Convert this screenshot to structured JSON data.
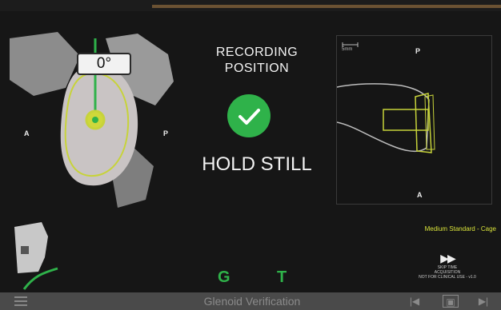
{
  "left_view": {
    "angle": "0°",
    "label_anterior": "A",
    "label_posterior": "P"
  },
  "status": {
    "line1": "RECORDING",
    "line2": "POSITION",
    "hold": "HOLD STILL"
  },
  "right_view": {
    "scale": "5mm",
    "label_top": "P",
    "label_bottom": "A"
  },
  "implant": "Medium Standard - Cage",
  "skip": {
    "line1": "SKIP TIME",
    "line2": "ACQUISITION",
    "line3": "NOT FOR CLINICAL USE - v1.0"
  },
  "mode_labels": {
    "g": "G",
    "t": "T"
  },
  "bottom_bar": {
    "title": "Glenoid Verification"
  },
  "colors": {
    "accent_green": "#2fb24a",
    "outline_yellow": "#c7d33a",
    "bar": "#4a4a4a"
  }
}
